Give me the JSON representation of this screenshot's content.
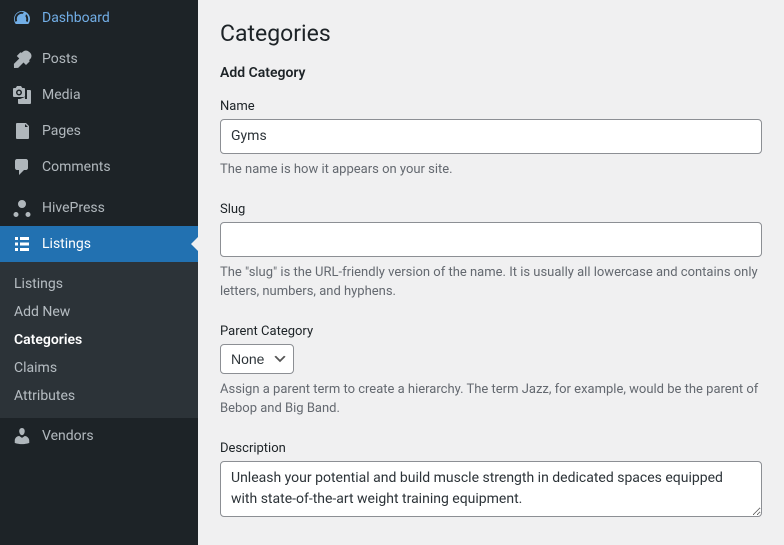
{
  "sidebar": {
    "items": [
      {
        "label": "Dashboard"
      },
      {
        "label": "Posts"
      },
      {
        "label": "Media"
      },
      {
        "label": "Pages"
      },
      {
        "label": "Comments"
      },
      {
        "label": "HivePress"
      },
      {
        "label": "Listings"
      },
      {
        "label": "Vendors"
      }
    ],
    "submenu": [
      {
        "label": "Listings"
      },
      {
        "label": "Add New"
      },
      {
        "label": "Categories"
      },
      {
        "label": "Claims"
      },
      {
        "label": "Attributes"
      }
    ]
  },
  "page": {
    "title": "Categories",
    "subtitle": "Add Category"
  },
  "form": {
    "name": {
      "label": "Name",
      "value": "Gyms",
      "description": "The name is how it appears on your site."
    },
    "slug": {
      "label": "Slug",
      "value": "",
      "description": "The \"slug\" is the URL-friendly version of the name. It is usually all lowercase and contains only letters, numbers, and hyphens."
    },
    "parent": {
      "label": "Parent Category",
      "selected": "None",
      "description": "Assign a parent term to create a hierarchy. The term Jazz, for example, would be the parent of Bebop and Big Band."
    },
    "description": {
      "label": "Description",
      "value": "Unleash your potential and build muscle strength in dedicated spaces equipped with state-of-the-art weight training equipment."
    }
  }
}
